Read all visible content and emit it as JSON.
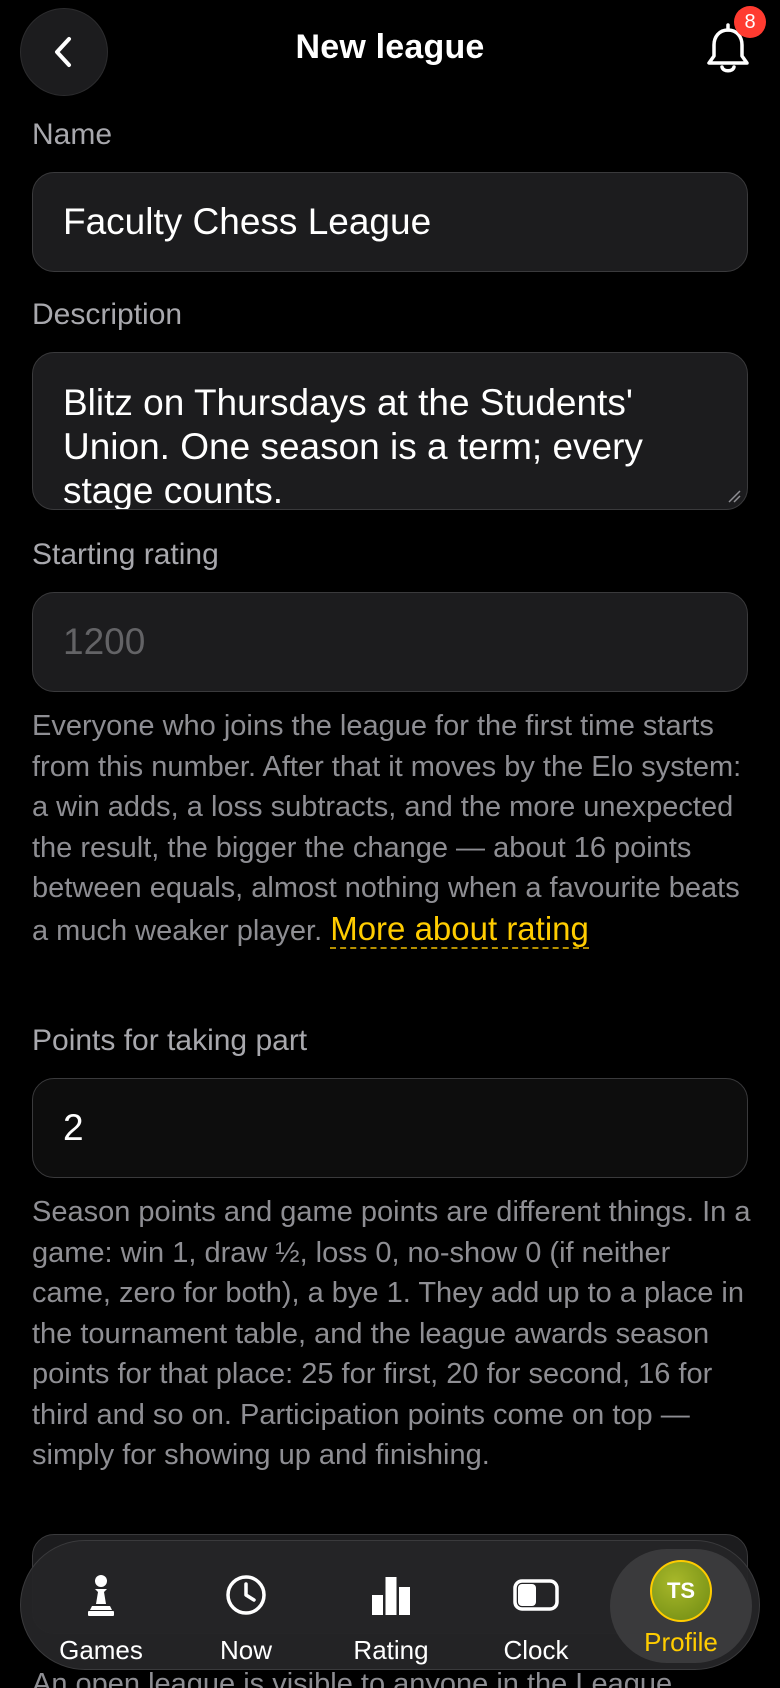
{
  "header": {
    "title": "New league",
    "notification_count": "8"
  },
  "form": {
    "name": {
      "label": "Name",
      "value": "Faculty Chess League"
    },
    "description": {
      "label": "Description",
      "value": "Blitz on Thursdays at the Students' Union. One season is a term; every stage counts."
    },
    "starting_rating": {
      "label": "Starting rating",
      "placeholder": "1200",
      "help": "Everyone who joins the league for the first time starts from this number. After that it moves by the Elo system: a win adds, a loss subtracts, and the more unexpected the result, the bigger the change — about 16 points between equals, almost nothing when a favourite beats a much weaker player.",
      "link": "More about rating"
    },
    "participation_points": {
      "label": "Points for taking part",
      "value": "2",
      "help": "Season points and game points are different things. In a game: win 1, draw ½, loss 0, no-show 0 (if neither came, zero for both), a bye 1. They add up to a place in the tournament table, and the league awards season points for that place: 25 for first, 20 for second, 16 for third and so on. Participation points come on top — simply for showing up and finishing."
    },
    "next_help_partial": "An open league is visible to anyone in the League"
  },
  "tabbar": {
    "tabs": [
      {
        "label": "Games",
        "icon": "pawn-icon"
      },
      {
        "label": "Now",
        "icon": "clock-icon"
      },
      {
        "label": "Rating",
        "icon": "bar-chart-icon"
      },
      {
        "label": "Clock",
        "icon": "chess-clock-icon"
      },
      {
        "label": "Profile",
        "icon": "avatar",
        "initials": "TS",
        "active": true
      }
    ]
  },
  "colors": {
    "accent": "#ffcc00",
    "background": "#000000",
    "field_background": "#1c1c1e",
    "badge": "#ff3b30",
    "muted_text": "#8e8e93"
  }
}
